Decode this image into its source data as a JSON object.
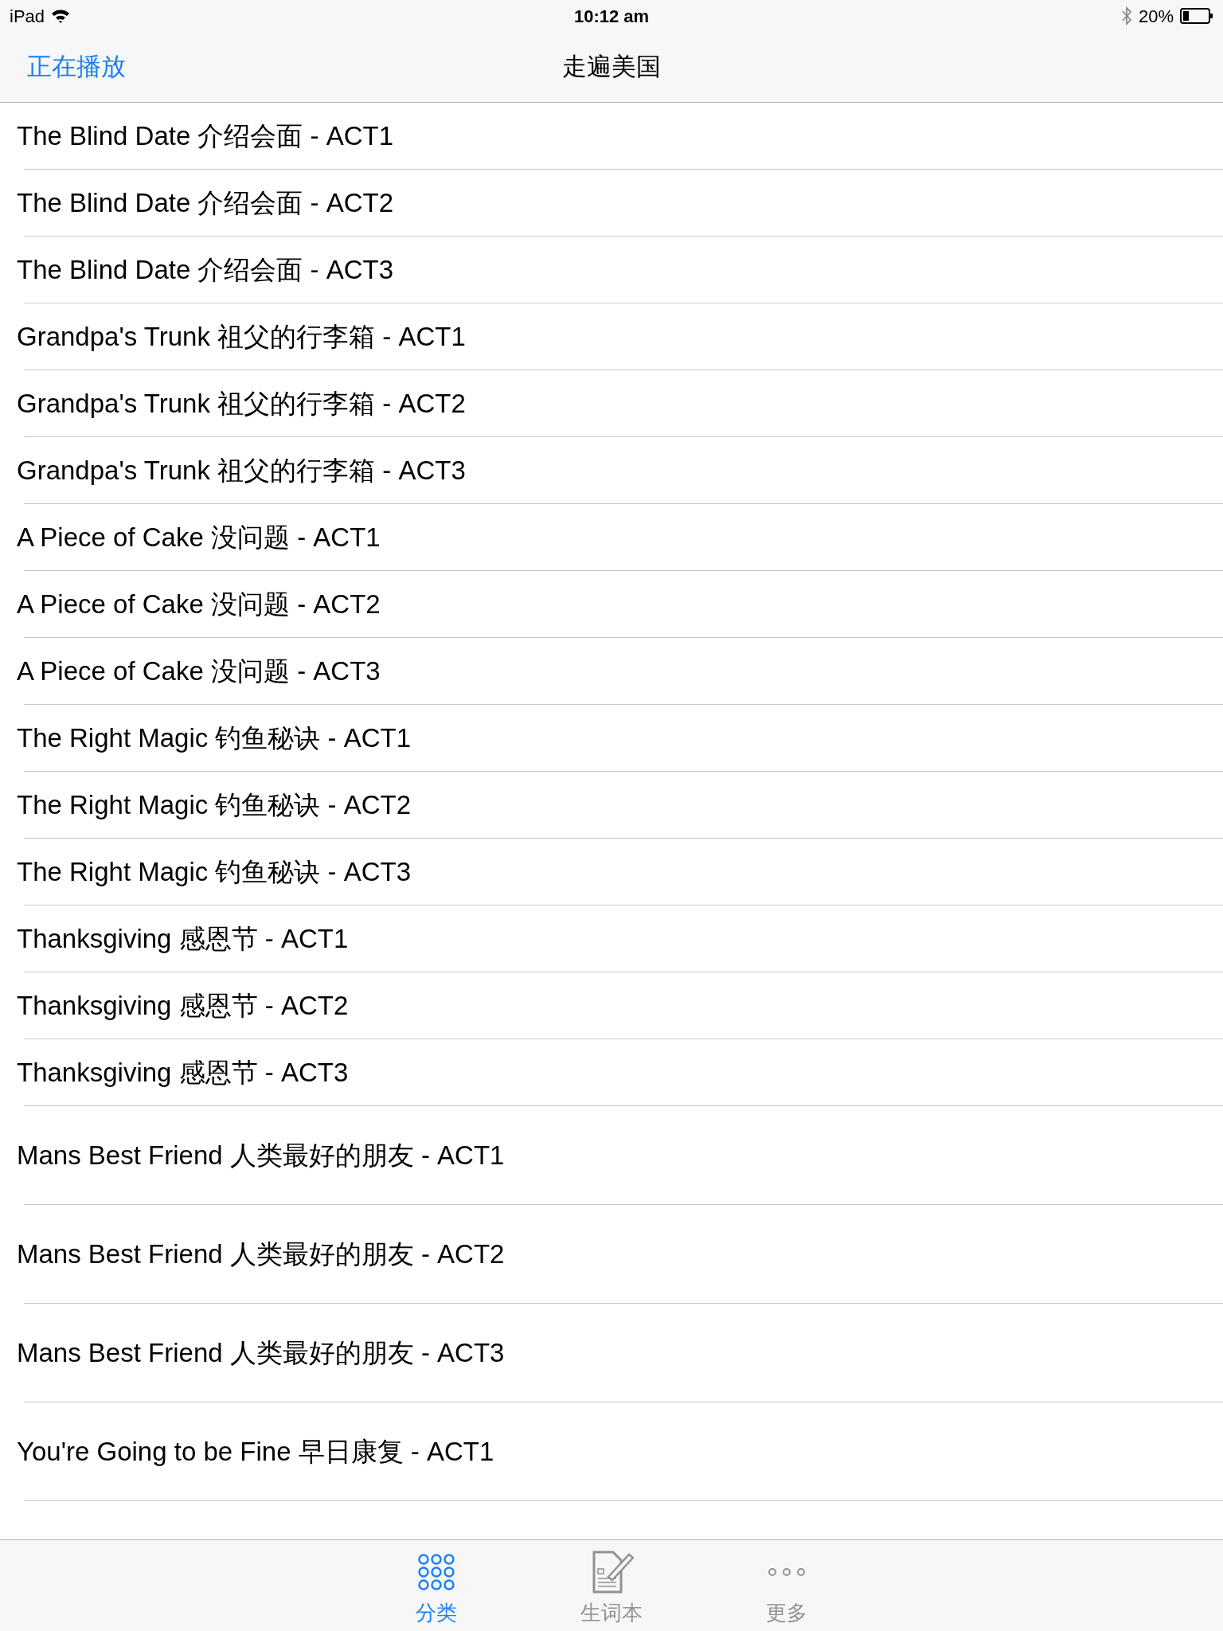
{
  "status_bar": {
    "device": "iPad",
    "time": "10:12 am",
    "battery": "20%"
  },
  "nav_bar": {
    "back": "正在播放",
    "title": "走遍美国"
  },
  "episodes": [
    {
      "title": "The Blind Date 介绍会面 - ACT1",
      "kind": "compact"
    },
    {
      "title": "The Blind Date 介绍会面 - ACT2",
      "kind": "compact"
    },
    {
      "title": "The Blind Date 介绍会面 - ACT3",
      "kind": "compact"
    },
    {
      "title": "Grandpa's Trunk 祖父的行李箱 - ACT1",
      "kind": "compact"
    },
    {
      "title": "Grandpa's Trunk 祖父的行李箱 - ACT2",
      "kind": "compact"
    },
    {
      "title": "Grandpa's Trunk 祖父的行李箱 - ACT3",
      "kind": "compact"
    },
    {
      "title": "A Piece of Cake 没问题 - ACT1",
      "kind": "compact"
    },
    {
      "title": "A Piece of Cake 没问题 - ACT2",
      "kind": "compact"
    },
    {
      "title": "A Piece of Cake 没问题 - ACT3",
      "kind": "compact"
    },
    {
      "title": "The Right Magic 钓鱼秘诀 - ACT1",
      "kind": "compact"
    },
    {
      "title": "The Right Magic 钓鱼秘诀 - ACT2",
      "kind": "compact"
    },
    {
      "title": "The Right Magic 钓鱼秘诀 - ACT3",
      "kind": "compact"
    },
    {
      "title": "Thanksgiving 感恩节 - ACT1",
      "kind": "compact"
    },
    {
      "title": "Thanksgiving 感恩节 - ACT2",
      "kind": "compact"
    },
    {
      "title": "Thanksgiving 感恩节 - ACT3",
      "kind": "compact"
    },
    {
      "title": "Mans Best Friend 人类最好的朋友 - ACT1",
      "kind": "tall"
    },
    {
      "title": "Mans Best Friend 人类最好的朋友 - ACT2",
      "kind": "tall"
    },
    {
      "title": "Mans Best Friend 人类最好的朋友 - ACT3",
      "kind": "tall"
    },
    {
      "title": "You're Going to be Fine 早日康复 - ACT1",
      "kind": "tall"
    }
  ],
  "tab_bar": [
    {
      "label": "分类",
      "kind": "grid",
      "selected": true
    },
    {
      "label": "生词本",
      "kind": "notebook",
      "selected": false
    },
    {
      "label": "更多",
      "kind": "more",
      "selected": false
    }
  ]
}
